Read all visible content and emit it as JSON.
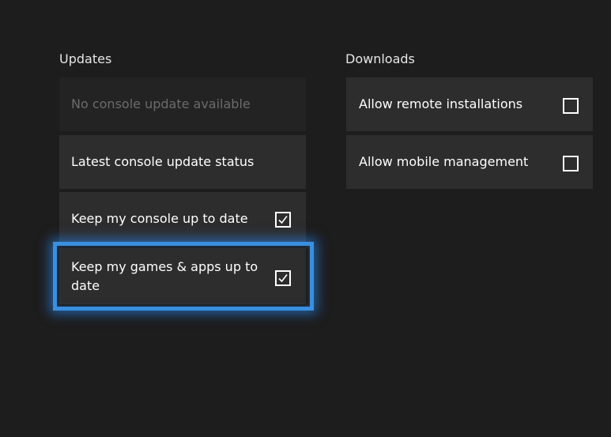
{
  "updates": {
    "title": "Updates",
    "items": [
      {
        "label": "No console update available",
        "state": "disabled"
      },
      {
        "label": "Latest console update status"
      },
      {
        "label": "Keep my console up to date",
        "checked": true
      },
      {
        "label": "Keep my games & apps up to date",
        "checked": true,
        "focused": true
      }
    ]
  },
  "downloads": {
    "title": "Downloads",
    "items": [
      {
        "label": "Allow remote installations",
        "checked": false
      },
      {
        "label": "Allow mobile management",
        "checked": false
      }
    ]
  },
  "colors": {
    "background": "#1d1d1d",
    "tile": "#2d2d2d",
    "focus_accent": "#3a8fe0"
  }
}
